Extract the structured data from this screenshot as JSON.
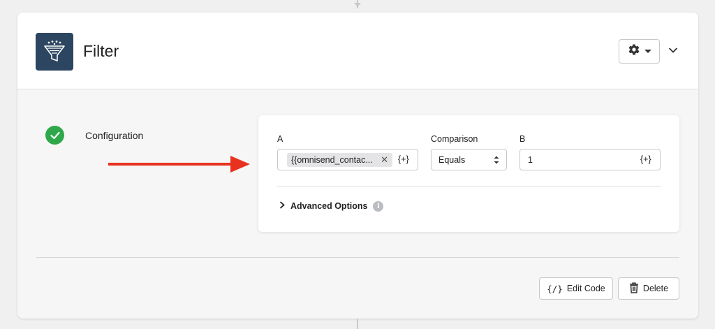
{
  "header": {
    "title": "Filter",
    "icon": "filter-funnel-icon"
  },
  "step": {
    "label": "Configuration",
    "status": "complete",
    "status_color": "#2ea84a"
  },
  "config": {
    "field_a": {
      "label": "A",
      "token": "{{omnisend_contac...",
      "insert_label": "{+}"
    },
    "comparison": {
      "label": "Comparison",
      "value": "Equals"
    },
    "field_b": {
      "label": "B",
      "value": "1",
      "insert_label": "{+}"
    },
    "advanced": {
      "label": "Advanced Options",
      "info": "i"
    }
  },
  "footer": {
    "edit_code_icon": "{/}",
    "edit_code_label": "Edit Code",
    "delete_label": "Delete"
  },
  "colors": {
    "arrow": "#e8321f",
    "app_icon_bg": "#2c4661",
    "success": "#2ea84a"
  }
}
